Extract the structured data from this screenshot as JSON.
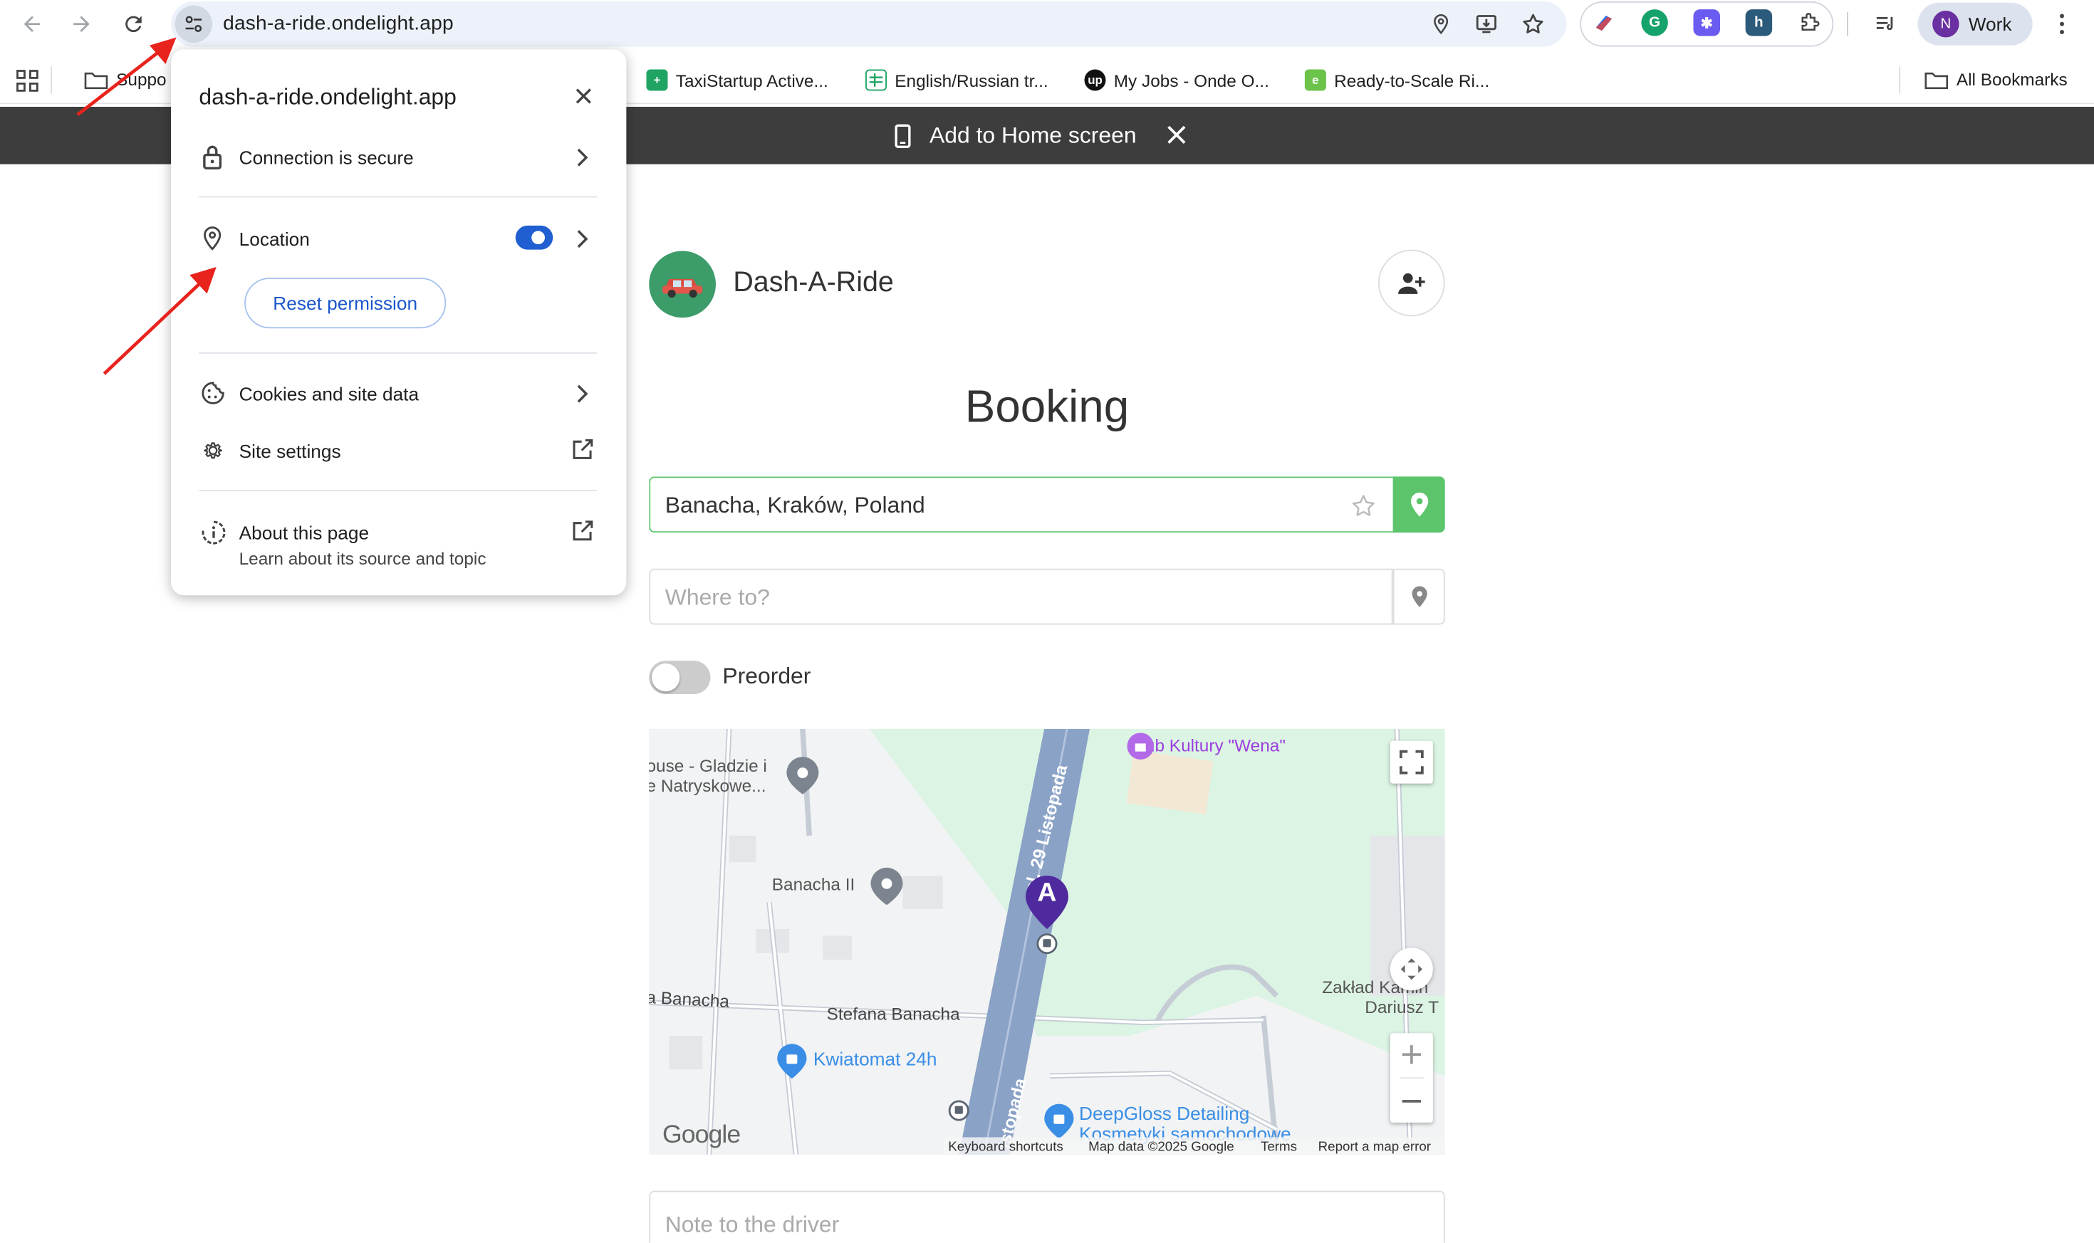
{
  "browser": {
    "url": "dash-a-ride.ondelight.app",
    "profile_initial": "N",
    "profile_name": "Work"
  },
  "bookmarks": {
    "items": [
      {
        "label": "Suppo"
      },
      {
        "label": "TaxiStartup Active..."
      },
      {
        "label": "English/Russian tr..."
      },
      {
        "label": "My Jobs - Onde O..."
      },
      {
        "label": "Ready-to-Scale Ri..."
      }
    ],
    "all_label": "All Bookmarks"
  },
  "install_bar": {
    "label": "Add to Home screen"
  },
  "site_info": {
    "title": "dash-a-ride.ondelight.app",
    "connection": "Connection is secure",
    "location": "Location",
    "location_enabled": true,
    "reset": "Reset permission",
    "cookies": "Cookies and site data",
    "settings": "Site settings",
    "about": "About this page",
    "about_sub": "Learn about its source and topic"
  },
  "app": {
    "name": "Dash-A-Ride",
    "heading": "Booking",
    "pickup_value": "Banacha, Kraków, Poland",
    "destination_placeholder": "Where to?",
    "preorder_label": "Preorder",
    "note_placeholder": "Note to the driver",
    "accent": "#5cc56b"
  },
  "map": {
    "labels": {
      "club": "Klub Kultury \"Wena\"",
      "house1": "ouse - Gladzie i",
      "house2": "e Natryskowe...",
      "banacha2": "Banacha II",
      "street_29": "al. 29 Listopada",
      "street_listopada": "istopada",
      "banacha": "a Banacha",
      "stefana": "Stefana Banacha",
      "kwiatomat": "Kwiatomat 24h",
      "zaklad1": "Zakład Kamin",
      "zaklad2": "Dariusz T",
      "deepgloss1": "DeepGloss Detailing",
      "deepgloss2": "Kosmetyki samochodowe",
      "marker": "A"
    },
    "google": "Google",
    "footer": {
      "shortcuts": "Keyboard shortcuts",
      "data": "Map data ©2025 Google",
      "terms": "Terms",
      "report": "Report a map error"
    }
  }
}
